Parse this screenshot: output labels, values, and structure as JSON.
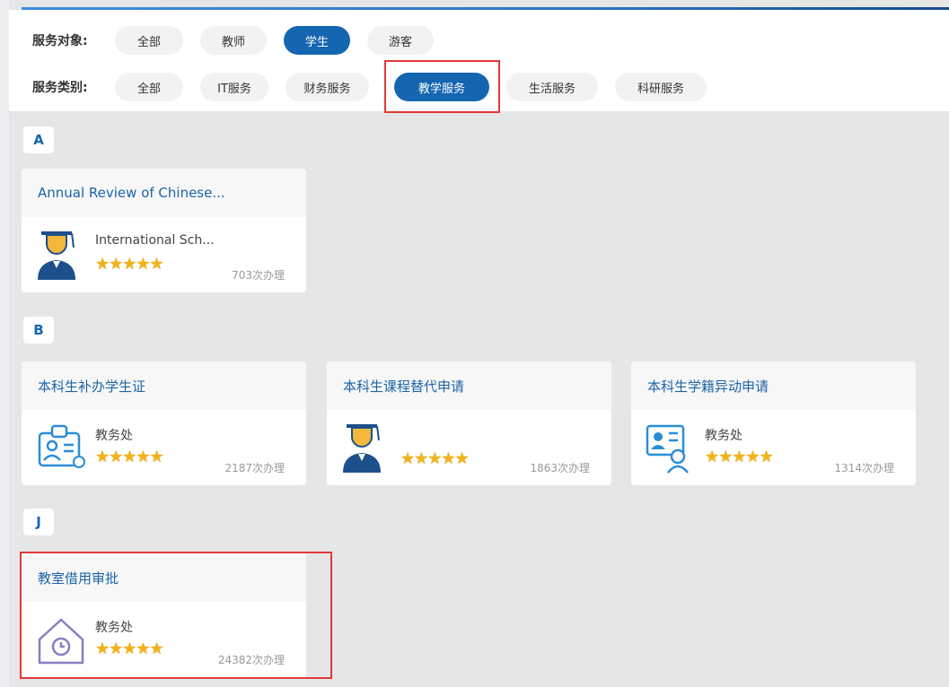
{
  "filters": {
    "audience": {
      "label": "服务对象:",
      "options": [
        "全部",
        "教师",
        "学生",
        "游客"
      ],
      "active": "学生"
    },
    "category": {
      "label": "服务类别:",
      "options": [
        "全部",
        "IT服务",
        "财务服务",
        "教学服务",
        "生活服务",
        "科研服务"
      ],
      "active": "教学服务"
    }
  },
  "groups": [
    {
      "letter": "A",
      "cards": [
        {
          "title": "Annual Review of Chinese...",
          "dept": "International Sch...",
          "count": "703次办理",
          "icon": "graduate-icon"
        }
      ]
    },
    {
      "letter": "B",
      "cards": [
        {
          "title": "本科生补办学生证",
          "dept": "教务处",
          "count": "2187次办理",
          "icon": "student-id-icon"
        },
        {
          "title": "本科生课程替代申请",
          "dept": "",
          "count": "1863次办理",
          "icon": "graduate-icon"
        },
        {
          "title": "本科生学籍异动申请",
          "dept": "教务处",
          "count": "1314次办理",
          "icon": "profile-card-icon"
        }
      ]
    },
    {
      "letter": "J",
      "cards": [
        {
          "title": "教室借用审批",
          "dept": "教务处",
          "count": "24382次办理",
          "icon": "house-clock-icon"
        }
      ]
    }
  ],
  "rating": "★★★★★",
  "colors": {
    "accent": "#1466b0",
    "highlight": "#e03a3a",
    "star": "#f2b21a"
  }
}
